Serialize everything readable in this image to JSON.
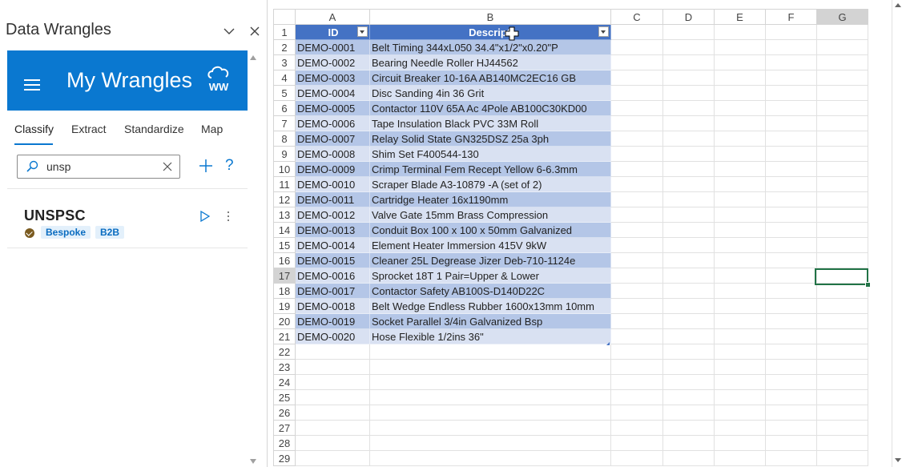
{
  "pane": {
    "title": "Data Wrangles",
    "app_title": "My Wrangles",
    "logo_text": "WW"
  },
  "tabs": [
    {
      "label": "Classify",
      "active": true
    },
    {
      "label": "Extract",
      "active": false
    },
    {
      "label": "Standardize",
      "active": false
    },
    {
      "label": "Map",
      "active": false
    }
  ],
  "search": {
    "value": "unsp",
    "help": "?"
  },
  "wrangle": {
    "name": "UNSPSC",
    "tags": [
      "Bespoke",
      "B2B"
    ]
  },
  "sheet": {
    "columns": [
      "A",
      "B",
      "C",
      "D",
      "E",
      "F",
      "G"
    ],
    "selected_column": "G",
    "selected_row": 17,
    "row_numbers": [
      "1",
      "2",
      "3",
      "4",
      "5",
      "6",
      "7",
      "8",
      "9",
      "10",
      "11",
      "12",
      "13",
      "14",
      "15",
      "16",
      "17",
      "18",
      "19",
      "20",
      "21",
      "22",
      "23",
      "24",
      "25",
      "26",
      "27",
      "28",
      "29"
    ],
    "header": {
      "id": "ID",
      "description": "Descripti"
    },
    "rows": [
      {
        "id": "DEMO-0001",
        "description": "Belt Timing 344xL050 34.4\"x1/2\"x0.20\"P"
      },
      {
        "id": "DEMO-0002",
        "description": "Bearing Needle Roller HJ44562"
      },
      {
        "id": "DEMO-0003",
        "description": "Circuit Breaker 10-16A AB140MC2EC16 GB"
      },
      {
        "id": "DEMO-0004",
        "description": "Disc Sanding 4in 36 Grit"
      },
      {
        "id": "DEMO-0005",
        "description": "Contactor 110V 65A Ac 4Pole AB100C30KD00"
      },
      {
        "id": "DEMO-0006",
        "description": "Tape Insulation Black PVC 33M Roll"
      },
      {
        "id": "DEMO-0007",
        "description": "Relay Solid State GN325DSZ 25a 3ph"
      },
      {
        "id": "DEMO-0008",
        "description": "Shim Set F400544-130"
      },
      {
        "id": "DEMO-0009",
        "description": "Crimp Terminal Fem Recept Yellow 6-6.3mm"
      },
      {
        "id": "DEMO-0010",
        "description": "Scraper Blade A3-10879 -A (set of 2)"
      },
      {
        "id": "DEMO-0011",
        "description": "Cartridge Heater 16x1190mm"
      },
      {
        "id": "DEMO-0012",
        "description": "Valve Gate 15mm Brass Compression"
      },
      {
        "id": "DEMO-0013",
        "description": "Conduit Box 100 x 100 x 50mm Galvanized"
      },
      {
        "id": "DEMO-0014",
        "description": "Element Heater Immersion 415V 9kW"
      },
      {
        "id": "DEMO-0015",
        "description": "Cleaner 25L Degrease Jizer Deb-710-1124e"
      },
      {
        "id": "DEMO-0016",
        "description": "Sprocket 18T 1 Pair=Upper & Lower"
      },
      {
        "id": "DEMO-0017",
        "description": "Contactor Safety AB100S-D140D22C"
      },
      {
        "id": "DEMO-0018",
        "description": "Belt Wedge Endless Rubber 1600x13mm 10mm"
      },
      {
        "id": "DEMO-0019",
        "description": "Socket Parallel 3/4in Galvanized Bsp"
      },
      {
        "id": "DEMO-0020",
        "description": "Hose Flexible 1/2ins 36\""
      }
    ]
  },
  "colors": {
    "accent": "#0a78d0",
    "table_header": "#4472c4",
    "band_dark": "#b4c6e7",
    "band_light": "#d9e1f2",
    "selection": "#217346"
  }
}
